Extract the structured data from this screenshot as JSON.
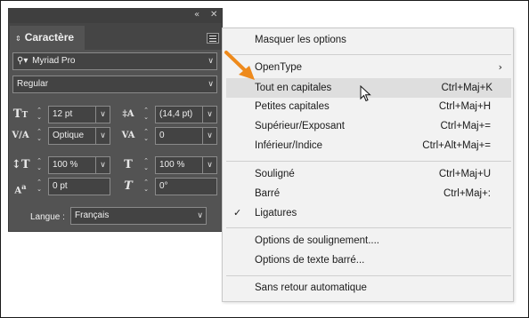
{
  "panel": {
    "title": "Caractère",
    "font_family": "Myriad Pro",
    "font_style": "Regular",
    "font_size": "12 pt",
    "leading": "(14,4 pt)",
    "kerning": "Optique",
    "tracking": "0",
    "vertical_scale": "100 %",
    "horizontal_scale": "100 %",
    "baseline_shift": "0 pt",
    "skew": "0°",
    "language_label": "Langue :",
    "language": "Français"
  },
  "menu": {
    "items": [
      {
        "label": "Masquer les options",
        "shortcut": ""
      },
      {
        "label": "OpenType",
        "shortcut": "",
        "submenu": true
      },
      {
        "label": "Tout en capitales",
        "shortcut": "Ctrl+Maj+K",
        "highlighted": true
      },
      {
        "label": "Petites capitales",
        "shortcut": "Ctrl+Maj+H"
      },
      {
        "label": "Supérieur/Exposant",
        "shortcut": "Ctrl+Maj+="
      },
      {
        "label": "Inférieur/Indice",
        "shortcut": "Ctrl+Alt+Maj+="
      },
      {
        "label": "Souligné",
        "shortcut": "Ctrl+Maj+U"
      },
      {
        "label": "Barré",
        "shortcut": "Ctrl+Maj+:"
      },
      {
        "label": "Ligatures",
        "shortcut": "",
        "checked": true
      },
      {
        "label": "Options de soulignement....",
        "shortcut": ""
      },
      {
        "label": "Options de texte barré...",
        "shortcut": ""
      },
      {
        "label": "Sans retour automatique",
        "shortcut": ""
      }
    ]
  },
  "icons": {
    "collapse": "double-chevron-icon",
    "close": "close-icon",
    "search": "search-icon",
    "submenu": "chevron-right-icon",
    "check": "check-icon",
    "annotation_arrow": "orange-arrow-icon",
    "cursor": "mouse-cursor-icon"
  },
  "colors": {
    "panel_bg": "#535353",
    "menu_bg": "#f2f2f2",
    "menu_highlight": "#dedede",
    "annotation_arrow": "#ee8a1c"
  }
}
